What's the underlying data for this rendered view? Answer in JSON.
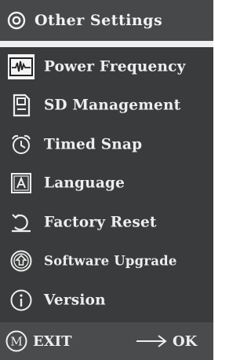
{
  "header": {
    "title": "Other Settings",
    "icon": "settings-icon"
  },
  "menu": {
    "items": [
      {
        "label": "Power Frequency",
        "icon": "waveform-icon",
        "selected": true
      },
      {
        "label": "SD Management",
        "icon": "sd-card-icon",
        "selected": false
      },
      {
        "label": "Timed Snap",
        "icon": "alarm-clock-icon",
        "selected": false
      },
      {
        "label": "Language",
        "icon": "language-icon",
        "selected": false
      },
      {
        "label": "Factory Reset",
        "icon": "reset-icon",
        "selected": false
      },
      {
        "label": "Software Upgrade",
        "icon": "upgrade-icon",
        "selected": false
      },
      {
        "label": "Version",
        "icon": "info-icon",
        "selected": false
      }
    ]
  },
  "footer": {
    "exit_label": "EXIT",
    "exit_key": "M",
    "ok_label": "OK"
  },
  "colors": {
    "background": "#3a3b3c",
    "header_background": "#474849",
    "footer_background": "#4a4b4c",
    "text": "#eeeeee",
    "selected_icon_background": "#f4f4f4"
  }
}
